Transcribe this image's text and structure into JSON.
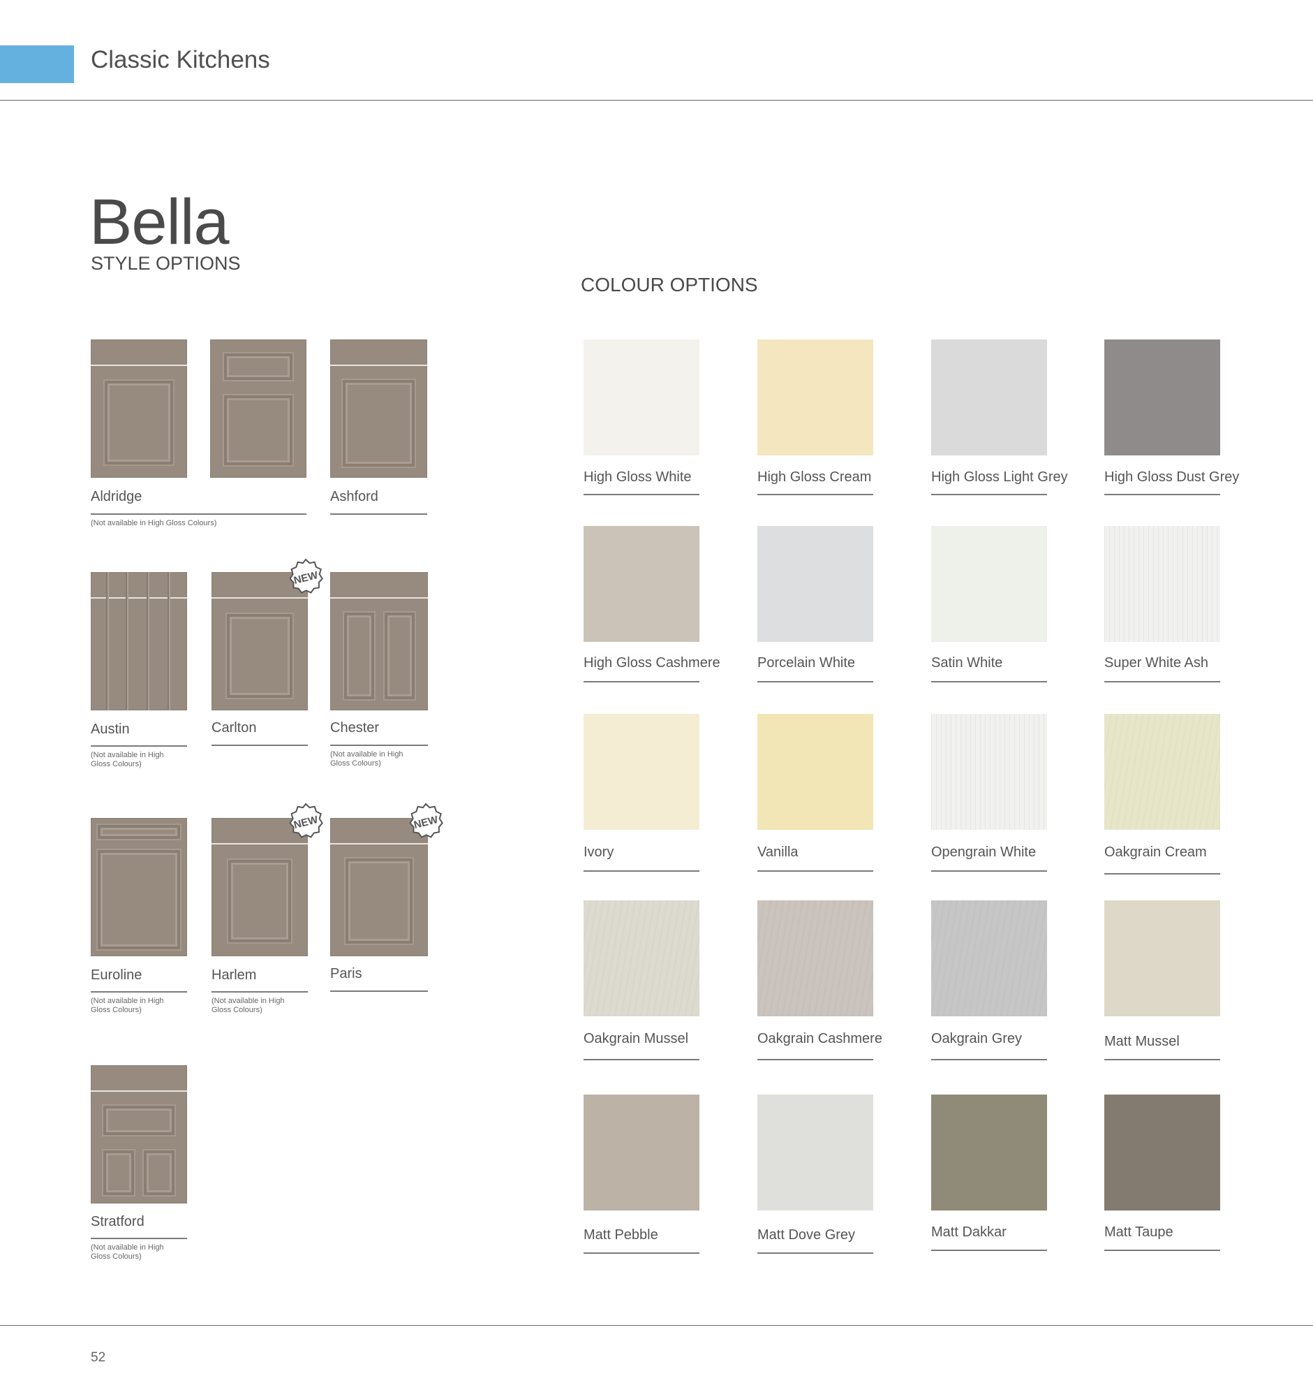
{
  "header": {
    "brand": "Classic Kitchens",
    "accent_color": "#64b1e0"
  },
  "title": "Bella",
  "style_heading": "STYLE OPTIONS",
  "colour_heading": "COLOUR OPTIONS",
  "badge_text": "NEW",
  "styles": [
    {
      "name": "Aldridge",
      "note": "(Not available in High Gloss Colours)"
    },
    {
      "name": "Ashford"
    },
    {
      "name": "Austin",
      "note": "(Not available in High Gloss Colours)"
    },
    {
      "name": "Carlton",
      "badge": true
    },
    {
      "name": "Chester",
      "note": "(Not available in High Gloss Colours)"
    },
    {
      "name": "Euroline",
      "note": "(Not available in High Gloss Colours)"
    },
    {
      "name": "Harlem",
      "badge": true,
      "note": "(Not available in High Gloss Colours)"
    },
    {
      "name": "Paris",
      "badge": true
    },
    {
      "name": "Stratford",
      "note": "(Not available in High Gloss Colours)"
    }
  ],
  "colours": [
    {
      "name": "High Gloss White",
      "color": "#f3f2ec"
    },
    {
      "name": "High Gloss Cream",
      "color": "#f4e6bf"
    },
    {
      "name": "High Gloss Light Grey",
      "color": "#dbdada"
    },
    {
      "name": "High Gloss Dust Grey",
      "color": "#8f8b8b"
    },
    {
      "name": "High Gloss Cashmere",
      "color": "#ccc3b8"
    },
    {
      "name": "Porcelain White",
      "color": "#dcdee0"
    },
    {
      "name": "Satin White",
      "color": "#eef0ea"
    },
    {
      "name": "Super White Ash",
      "color": "#f1f2f0"
    },
    {
      "name": "Ivory",
      "color": "#f5ecd4"
    },
    {
      "name": "Vanilla",
      "color": "#f2e6b6"
    },
    {
      "name": "Opengrain White",
      "color": "#f1f1ef"
    },
    {
      "name": "Oakgrain Cream",
      "color": "#e8e6c9"
    },
    {
      "name": "Oakgrain Mussel",
      "color": "#dddbcf"
    },
    {
      "name": "Oakgrain Cashmere",
      "color": "#cbc3bd"
    },
    {
      "name": "Oakgrain Grey",
      "color": "#c6c6c6"
    },
    {
      "name": "Matt Mussel",
      "color": "#ddd8c8"
    },
    {
      "name": "Matt Pebble",
      "color": "#bcb2a6"
    },
    {
      "name": "Matt Dove Grey",
      "color": "#dfe0dc"
    },
    {
      "name": "Matt Dakkar",
      "color": "#908a78"
    },
    {
      "name": "Matt Taupe",
      "color": "#837a70"
    }
  ],
  "page_number": "52"
}
